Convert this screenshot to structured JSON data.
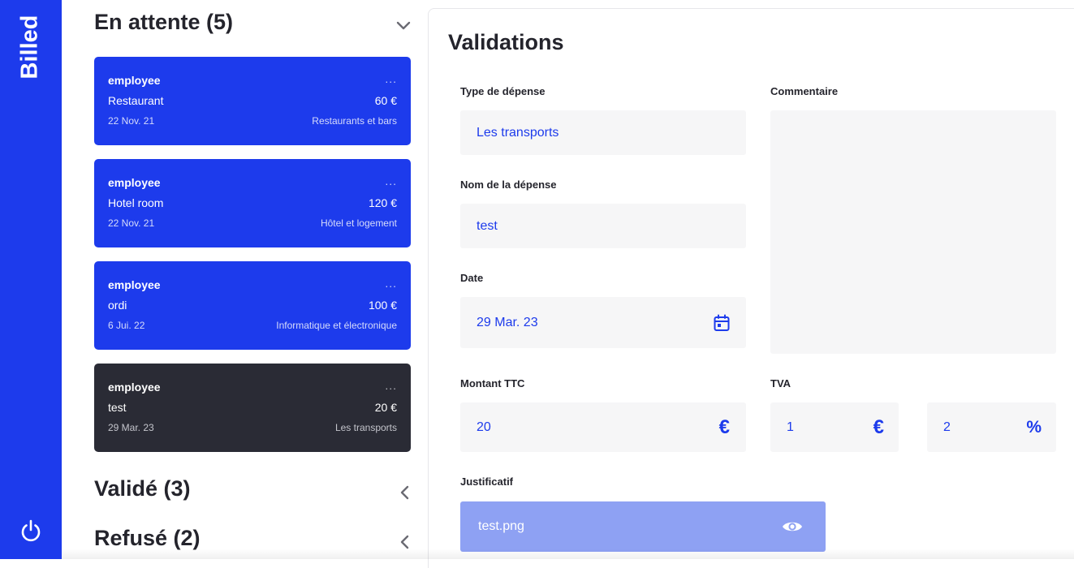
{
  "brand": "Billed",
  "sections": [
    {
      "title": "En attente (5)"
    },
    {
      "title": "Validé (3)"
    },
    {
      "title": "Refusé (2)"
    }
  ],
  "bills": [
    {
      "employee": "employee",
      "dots": "...",
      "name": "Restaurant",
      "amount": "60 €",
      "date": "22 Nov. 21",
      "type": "Restaurants et bars"
    },
    {
      "employee": "employee",
      "dots": "...",
      "name": "Hotel room",
      "amount": "120 €",
      "date": "22 Nov. 21",
      "type": "Hôtel et logement"
    },
    {
      "employee": "employee",
      "dots": "...",
      "name": "ordi",
      "amount": "100 €",
      "date": "6 Jui. 22",
      "type": "Informatique et électronique"
    },
    {
      "employee": "employee",
      "dots": "...",
      "name": "test",
      "amount": "20 €",
      "date": "29 Mar. 23",
      "type": "Les transports"
    }
  ],
  "panel": {
    "title": "Validations",
    "type_label": "Type de dépense",
    "type_value": "Les transports",
    "name_label": "Nom de la dépense",
    "name_value": "test",
    "date_label": "Date",
    "date_value": "29 Mar. 23",
    "comment_label": "Commentaire",
    "amount_label": "Montant TTC",
    "amount_value": "20",
    "amount_unit": "€",
    "tva_label": "TVA",
    "tva_value": "1",
    "tva_unit": "€",
    "pct_value": "2",
    "pct_unit": "%",
    "file_label": "Justificatif",
    "file_name": "test.png"
  },
  "icons": {
    "logout": "power-icon",
    "calendar": "calendar-icon",
    "eye": "eye-icon",
    "expanded": "chevron-down-icon",
    "collapsed": "chevron-left-icon"
  },
  "colors": {
    "brand_blue": "#1d3bec",
    "selected_card": "#2a2b35",
    "file_box": "#8ea1f3",
    "field_bg": "#f6f6f7"
  }
}
